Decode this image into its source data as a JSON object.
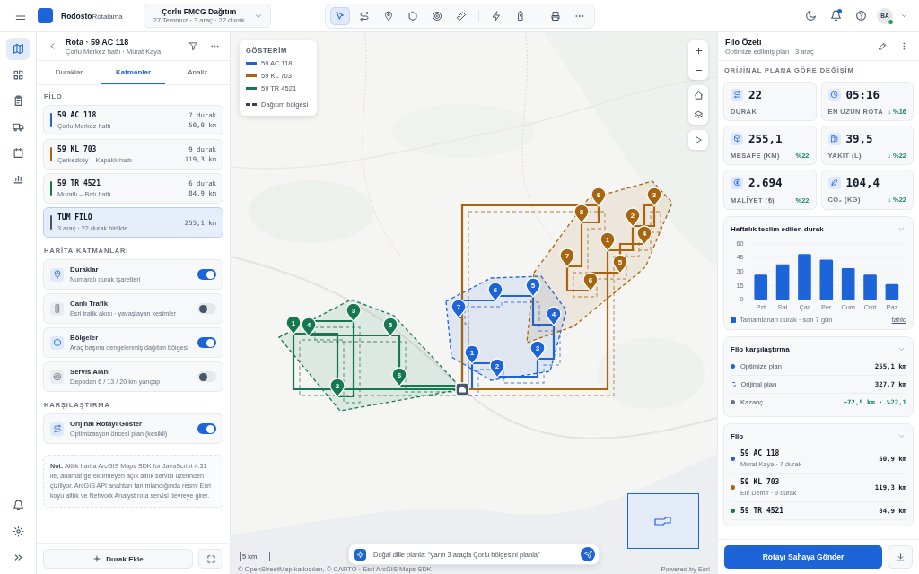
{
  "topbar": {
    "brand_bold": "Rodosto",
    "brand_light": "Rotalama",
    "project": {
      "title": "Çorlu FMCG Dağıtım",
      "subtitle": "27 Temmuz · 3 araç · 22 durak"
    },
    "tool_groups": [
      [
        {
          "kind": "select",
          "selected": true
        },
        {
          "kind": "route",
          "selected": false
        },
        {
          "kind": "pin",
          "selected": false
        },
        {
          "kind": "polygon",
          "selected": false
        },
        {
          "kind": "target",
          "selected": false
        },
        {
          "kind": "ruler",
          "selected": false
        }
      ],
      [
        {
          "kind": "bolt",
          "selected": false
        },
        {
          "kind": "battery",
          "selected": false
        }
      ],
      [
        {
          "kind": "print",
          "selected": false
        },
        {
          "kind": "more",
          "selected": false
        }
      ]
    ],
    "bell_badge": true,
    "avatar": {
      "initials": "BA",
      "online": true
    }
  },
  "rail": {
    "items": [
      {
        "kind": "map",
        "selected": true
      },
      {
        "kind": "grid",
        "selected": false
      },
      {
        "kind": "clipboard",
        "selected": false
      },
      {
        "kind": "truck",
        "selected": false
      },
      {
        "kind": "calendar",
        "selected": false
      },
      {
        "kind": "chart",
        "selected": false
      }
    ],
    "bottom": [
      {
        "kind": "bell"
      },
      {
        "kind": "gear"
      },
      {
        "kind": "chevrons"
      }
    ]
  },
  "route_panel": {
    "title": "Rota · 59 AC 118",
    "subtitle": "Çorlu Merkez hattı · Murat Kaya",
    "tabs": [
      {
        "label": "Duraklar",
        "selected": false
      },
      {
        "label": "Katmanlar",
        "selected": true
      },
      {
        "label": "Analiz",
        "selected": false
      }
    ],
    "fleet_heading": "FİLO",
    "vehicles": [
      {
        "plate": "59 AC 118",
        "line": "Çorlu Merkez hattı",
        "stops": "7 durak",
        "distance": "50,9 km",
        "color": "#1d64d8",
        "selected": false
      },
      {
        "plate": "59 KL 703",
        "line": "Çerkezköy – Kapaklı hattı",
        "stops": "9 durak",
        "distance": "119,3 km",
        "color": "#a8650f",
        "selected": false
      },
      {
        "plate": "59 TR 4521",
        "line": "Muratlı – Batı hattı",
        "stops": "6 durak",
        "distance": "84,9 km",
        "color": "#17784f",
        "selected": false
      },
      {
        "plate": "TÜM FİLO",
        "line": "3 araç · 22 durak birlikte",
        "distance": "255,1 km",
        "color": "#4b5563",
        "selected": true
      }
    ],
    "layers_heading": "HARİTA KATMANLARI",
    "layers": [
      {
        "kind": "pin",
        "title": "Duraklar",
        "subtitle": "Numaralı durak işaretleri",
        "on": true
      },
      {
        "kind": "traffic",
        "title": "Canlı Trafik",
        "subtitle": "Esri trafik akışı · yavaşlayan kesimler",
        "on": false
      },
      {
        "kind": "polygon",
        "title": "Bölgeler",
        "subtitle": "Araç başına dengelenmiş dağıtım bölgesi",
        "on": true
      },
      {
        "kind": "target",
        "title": "Servis Alanı",
        "subtitle": "Depodan 6 / 13 / 20 km yarıçap",
        "on": false
      }
    ],
    "compare_heading": "KARŞILAŞTIRMA",
    "compare": [
      {
        "kind": "route",
        "title": "Orijinal Rotayı Göster",
        "subtitle": "Optimizasyon öncesi plan (kesikli)",
        "on": true
      }
    ],
    "note": "**Not:** Altlık harita ArcGIS Maps SDK for JavaScript 4.31 ile, anahtar gerektirmeyen açık altlık servisi üzerinden çiziliyor. ArcGIS API anahtarı tanımlandığında resmi Esri koyu altlık ve Network Analyst rota servisi devreye girer.",
    "add_button": "Durak Ekle"
  },
  "map": {
    "legend": {
      "title": "GÖSTERİM",
      "items": [
        {
          "kind": "line",
          "label": "59 AC 118",
          "color": "#1d64d8"
        },
        {
          "kind": "line",
          "label": "59 KL 703",
          "color": "#a8650f"
        },
        {
          "kind": "line",
          "label": "59 TR 4521",
          "color": "#17784f"
        },
        {
          "kind": "dashed",
          "label": "Dağıtım bölgesi",
          "color": "#334155"
        }
      ]
    },
    "routes": [
      {
        "color": "#1d64d8",
        "stops": [
          "1",
          "2",
          "3",
          "4",
          "5",
          "6",
          "7"
        ]
      },
      {
        "color": "#a8650f",
        "stops": [
          "1",
          "2",
          "3",
          "4",
          "5",
          "6",
          "7",
          "8",
          "9"
        ]
      },
      {
        "color": "#17784f",
        "stops": [
          "1",
          "2",
          "3",
          "4",
          "5",
          "6"
        ]
      }
    ],
    "chat_placeholder": "Doğal dille planla: “yarın 3 araçla Çorlu bölgesini planla”",
    "scale": "5 km",
    "attribution": "© OpenStreetMap katkıcıları, © CARTO · Esri ArcGIS Maps SDK",
    "powered": "Powered by Esri"
  },
  "summary": {
    "title": "Filo Özeti",
    "subtitle": "Optimize edilmiş plan · 3 araç",
    "heading": "ORİJİNAL PLANA GÖRE DEĞİŞİM",
    "stats": [
      {
        "kind": "route",
        "value": "22",
        "label": "DURAK"
      },
      {
        "kind": "clock",
        "value": "05:16",
        "label": "EN UZUN ROTA",
        "delta": "↓ %16"
      },
      {
        "kind": "box",
        "value": "255,1",
        "label": "MESAFE (KM)",
        "delta": "↓ %22"
      },
      {
        "kind": "fuel",
        "value": "39,5",
        "label": "YAKIT (L)",
        "delta": "↓ %22"
      },
      {
        "kind": "coin",
        "value": "2.694",
        "label": "MALİYET (₺)",
        "delta": "↓ %22"
      },
      {
        "kind": "leaf",
        "value": "104,4",
        "label": "CO₂ (KG)",
        "delta": "↓ %22"
      }
    ],
    "chart": {
      "title": "Haftalık teslim edilen durak",
      "legend": "Tamamlanan durak · son 7 gün",
      "link": "tablo",
      "chart_data": {
        "type": "bar",
        "categories": [
          "Pzt",
          "Sal",
          "Çar",
          "Per",
          "Cum",
          "Cmt",
          "Paz"
        ],
        "values": [
          27,
          38,
          49,
          43,
          34,
          27,
          17
        ],
        "ylim": [
          0,
          60
        ],
        "yticks": [
          0,
          15,
          30,
          45,
          60
        ]
      }
    },
    "comparison": {
      "title": "Filo karşılaştırma",
      "rows": [
        {
          "kind": "optimized",
          "label": "Optimize plan",
          "value": "255,1 km"
        },
        {
          "kind": "original",
          "label": "Orijinal plan",
          "value": "327,7 km"
        },
        {
          "kind": "saving",
          "label": "Kazanç",
          "value": "−72,5 km · %22,1"
        }
      ]
    },
    "fleet": {
      "title": "Filo",
      "rows": [
        {
          "plate": "59 AC 118",
          "subtitle": "Murat Kaya · 7 durak",
          "distance": "50,9 km",
          "color": "#1d64d8"
        },
        {
          "plate": "59 KL 703",
          "subtitle": "Elif Demir · 9 durak",
          "distance": "119,3 km",
          "color": "#a8650f"
        },
        {
          "plate": "59 TR 4521",
          "distance": "84,9 km",
          "color": "#17784f"
        }
      ]
    },
    "send_button": "Rotayı Sahaya Gönder"
  }
}
